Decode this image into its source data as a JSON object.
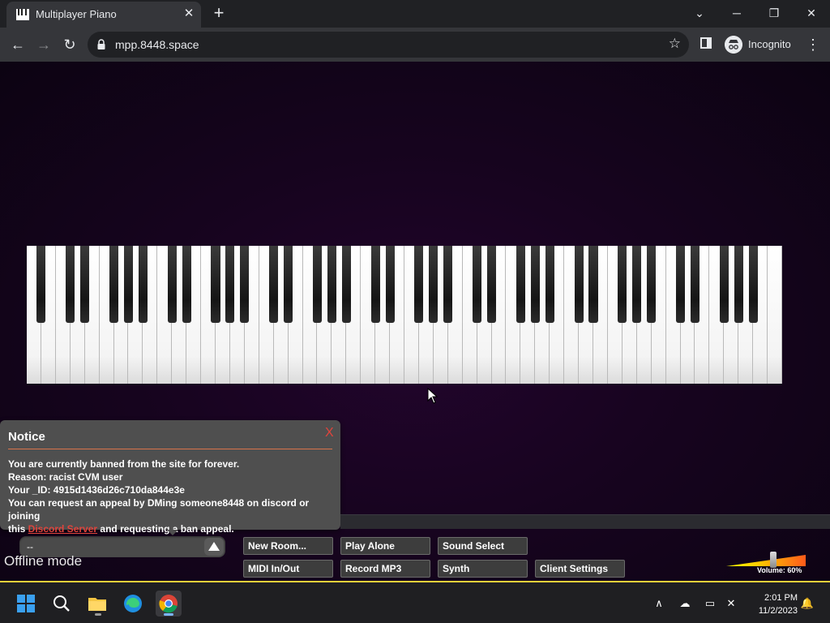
{
  "browser": {
    "tab_title": "Multiplayer Piano",
    "tab_close": "✕",
    "new_tab": "+",
    "url": "mpp.8448.space",
    "profile_label": "Incognito",
    "window_minimize": "─",
    "window_restore": "❐",
    "window_close": "✕",
    "tab_search": "⌄"
  },
  "piano": {
    "white_key_count": 52,
    "black_key_count": 36
  },
  "notice": {
    "title": "Notice",
    "close_label": "X",
    "line1": "You are currently banned from the site for forever.",
    "line2": "Reason: racist CVM user",
    "line3": "Your _ID: 4915d1436d26c710da844e3e",
    "line4": "You can request an appeal by DMing someone8448 on discord or joining",
    "line5_prefix": "this ",
    "line5_link": "Discord Server",
    "line5_suffix": " and requesting a ban appeal."
  },
  "controls": {
    "room_value": "--",
    "status": "Offline mode",
    "new_room": "New Room...",
    "play_alone": "Play Alone",
    "sound_select": "Sound Select",
    "midi": "MIDI In/Out",
    "record_mp3": "Record MP3",
    "synth": "Synth",
    "client_settings": "Client Settings",
    "volume_label": "Volume: 60%",
    "volume_level": 0.6
  },
  "taskbar": {
    "time": "2:01 PM",
    "date": "11/2/2023"
  },
  "colors": {
    "page_bg": "#17041f",
    "accent_line": "#f2d13a",
    "notice_bg": "#4f4f4f",
    "link_red": "#e0443c"
  }
}
